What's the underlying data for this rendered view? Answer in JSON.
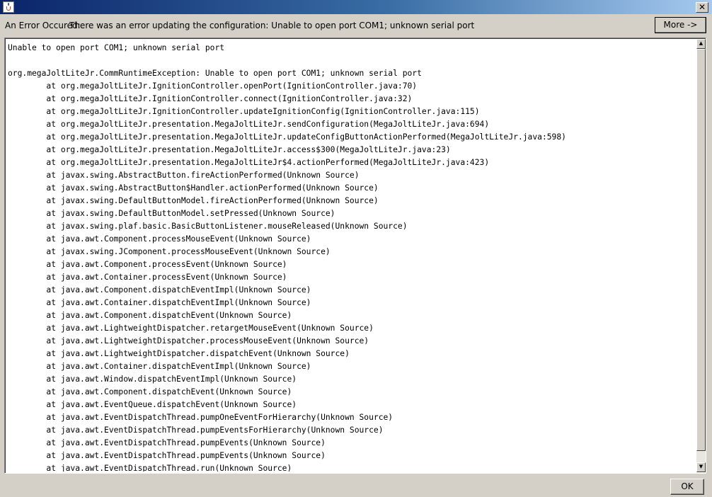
{
  "window": {
    "title": "",
    "close_glyph": "✕",
    "title_icon": "java-cup-icon"
  },
  "message": {
    "label": "An Error Occured:",
    "text": "There was an error updating the configuration: Unable to open port COM1; unknown serial port"
  },
  "buttons": {
    "more_label": "More ->",
    "ok_label": "OK"
  },
  "details": {
    "lines": [
      "Unable to open port COM1; unknown serial port",
      "",
      "org.megaJoltLiteJr.CommRuntimeException: Unable to open port COM1; unknown serial port",
      "        at org.megaJoltLiteJr.IgnitionController.openPort(IgnitionController.java:70)",
      "        at org.megaJoltLiteJr.IgnitionController.connect(IgnitionController.java:32)",
      "        at org.megaJoltLiteJr.IgnitionController.updateIgnitionConfig(IgnitionController.java:115)",
      "        at org.megaJoltLiteJr.presentation.MegaJoltLiteJr.sendConfiguration(MegaJoltLiteJr.java:694)",
      "        at org.megaJoltLiteJr.presentation.MegaJoltLiteJr.updateConfigButtonActionPerformed(MegaJoltLiteJr.java:598)",
      "        at org.megaJoltLiteJr.presentation.MegaJoltLiteJr.access$300(MegaJoltLiteJr.java:23)",
      "        at org.megaJoltLiteJr.presentation.MegaJoltLiteJr$4.actionPerformed(MegaJoltLiteJr.java:423)",
      "        at javax.swing.AbstractButton.fireActionPerformed(Unknown Source)",
      "        at javax.swing.AbstractButton$Handler.actionPerformed(Unknown Source)",
      "        at javax.swing.DefaultButtonModel.fireActionPerformed(Unknown Source)",
      "        at javax.swing.DefaultButtonModel.setPressed(Unknown Source)",
      "        at javax.swing.plaf.basic.BasicButtonListener.mouseReleased(Unknown Source)",
      "        at java.awt.Component.processMouseEvent(Unknown Source)",
      "        at javax.swing.JComponent.processMouseEvent(Unknown Source)",
      "        at java.awt.Component.processEvent(Unknown Source)",
      "        at java.awt.Container.processEvent(Unknown Source)",
      "        at java.awt.Component.dispatchEventImpl(Unknown Source)",
      "        at java.awt.Container.dispatchEventImpl(Unknown Source)",
      "        at java.awt.Component.dispatchEvent(Unknown Source)",
      "        at java.awt.LightweightDispatcher.retargetMouseEvent(Unknown Source)",
      "        at java.awt.LightweightDispatcher.processMouseEvent(Unknown Source)",
      "        at java.awt.LightweightDispatcher.dispatchEvent(Unknown Source)",
      "        at java.awt.Container.dispatchEventImpl(Unknown Source)",
      "        at java.awt.Window.dispatchEventImpl(Unknown Source)",
      "        at java.awt.Component.dispatchEvent(Unknown Source)",
      "        at java.awt.EventQueue.dispatchEvent(Unknown Source)",
      "        at java.awt.EventDispatchThread.pumpOneEventForHierarchy(Unknown Source)",
      "        at java.awt.EventDispatchThread.pumpEventsForHierarchy(Unknown Source)",
      "        at java.awt.EventDispatchThread.pumpEvents(Unknown Source)",
      "        at java.awt.EventDispatchThread.pumpEvents(Unknown Source)",
      "        at java.awt.EventDispatchThread.run(Unknown Source)"
    ]
  },
  "scrollbar": {
    "up_glyph": "▲",
    "down_glyph": "▼"
  },
  "colors": {
    "titlebar_start": "#0a246a",
    "titlebar_end": "#a6caf0",
    "face": "#d4d0c8"
  }
}
